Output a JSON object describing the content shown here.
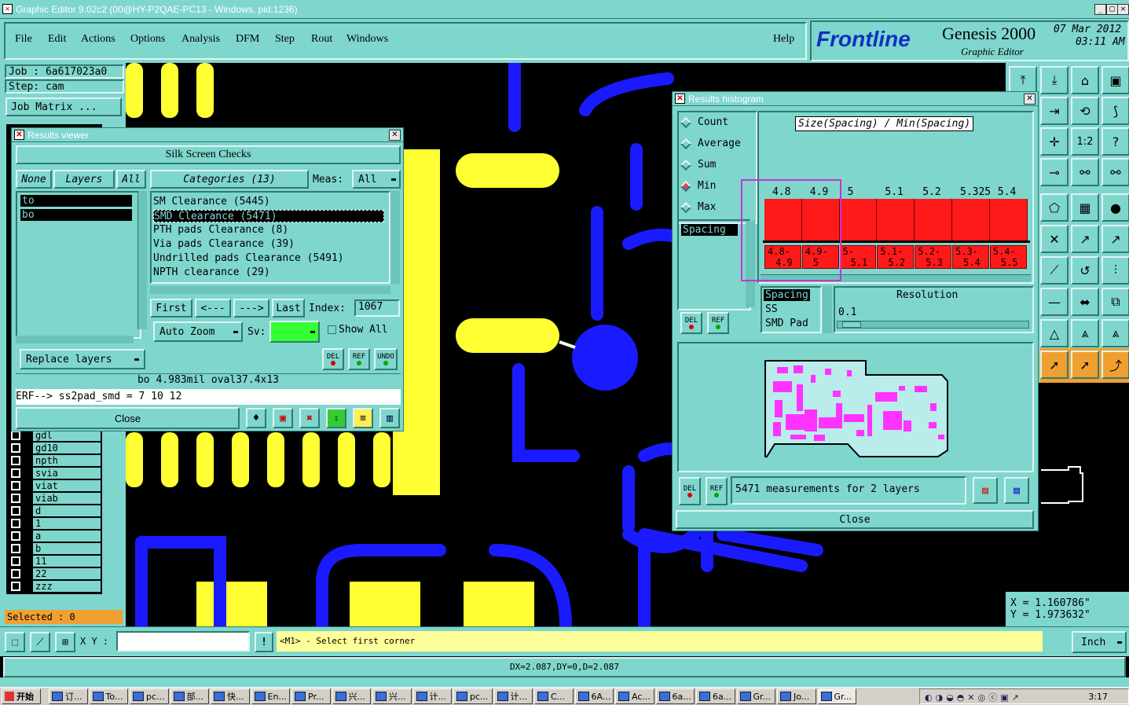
{
  "window": {
    "title": "Graphic Editor 9.02c2 (00@HY-P2QAE-PC13 - Windows, pid:1236)"
  },
  "menu": {
    "items": [
      "File",
      "Edit",
      "Actions",
      "Options",
      "Analysis",
      "DFM",
      "Step",
      "Rout",
      "Windows"
    ],
    "help": "Help"
  },
  "brand": {
    "logo": "Frontline",
    "product": "Genesis 2000",
    "subtitle": "Graphic Editor",
    "date": "07 Mar 2012",
    "time": "03:11 AM"
  },
  "job": {
    "job_label": "Job : 6a617023a0",
    "step_label": "Step: cam",
    "matrix_button": "Job Matrix ..."
  },
  "layers": [
    "gdl",
    "gd10",
    "npth",
    "svia",
    "viat",
    "viab",
    "d",
    "1",
    "a",
    "b",
    "11",
    "22",
    "zzz"
  ],
  "selected": "Selected : 0",
  "results_viewer": {
    "title": "Results viewer",
    "header": "Silk Screen Checks",
    "none_btn": "None",
    "layers_btn": "Layers",
    "all_btn": "All",
    "layer_list": [
      "to",
      "bo"
    ],
    "categories_label": "Categories (13)",
    "meas_label": "Meas:",
    "meas_value": "All",
    "categories": [
      "SM Clearance (5445)",
      "SMD Clearance (5471)",
      "PTH pads Clearance (8)",
      "Via pads Clearance (39)",
      "Undrilled pads Clearance (5491)",
      "NPTH clearance (29)"
    ],
    "nav": {
      "first": "First",
      "prev": "<---",
      "next": "--->",
      "last": "Last",
      "index_label": "Index:",
      "index_value": "1067"
    },
    "auto_zoom": "Auto Zoom",
    "sv_label": "Sv:",
    "show_all": "Show All",
    "replace_layers": "Replace layers",
    "del": "DEL",
    "ref": "REF",
    "undo": "UNDO",
    "status": "bo 4.983mil  oval37.4x13",
    "erf": "ERF--> ss2pad_smd = 7 10 12",
    "close": "Close"
  },
  "histogram": {
    "title": "Results histogram",
    "radio_options": [
      "Count",
      "Average",
      "Sum",
      "Min",
      "Max"
    ],
    "selected_radio": "Min",
    "list_item": "Spacing",
    "chart_title": "Size(Spacing) / Min(Spacing)",
    "bar_top_labels": [
      "4.8",
      "4.9",
      "5",
      "5.1",
      "5.2",
      "5.325",
      "5.4"
    ],
    "range_labels": [
      [
        "4.8-",
        "4.9"
      ],
      [
        "4.9-",
        "5"
      ],
      [
        "5-",
        "5.1"
      ],
      [
        "5.1-",
        "5.2"
      ],
      [
        "5.2-",
        "5.3"
      ],
      [
        "5.3-",
        "5.4"
      ],
      [
        "5.4-",
        "5.5"
      ]
    ],
    "bar_color": "#ff1a1a",
    "highlight_color": "#cc33cc",
    "props": [
      "Spacing",
      "SS",
      "SMD Pad"
    ],
    "resolution_label": "Resolution",
    "resolution_value": "0.1",
    "del": "DEL",
    "ref": "REF",
    "summary": "5471 measurements for 2 layers",
    "close": "Close"
  },
  "coords": {
    "x": "X = 1.160786\"",
    "y": "Y = 1.973632\""
  },
  "command": {
    "xy_label": "X Y :",
    "prompt": "<M1> - Select first corner",
    "units": "Inch"
  },
  "status_line": "DX=2.087,DY=0,D=2.087",
  "taskbar": {
    "start": "开始",
    "items": [
      "订...",
      "To...",
      "pc...",
      "部...",
      "快...",
      "En...",
      "Pr...",
      "兴...",
      "兴...",
      "计...",
      "pc...",
      "计...",
      "C...",
      "6A...",
      "Ac...",
      "6a...",
      "6a...",
      "Gr...",
      "Jo...",
      "Gr..."
    ],
    "clock": "3:17"
  }
}
